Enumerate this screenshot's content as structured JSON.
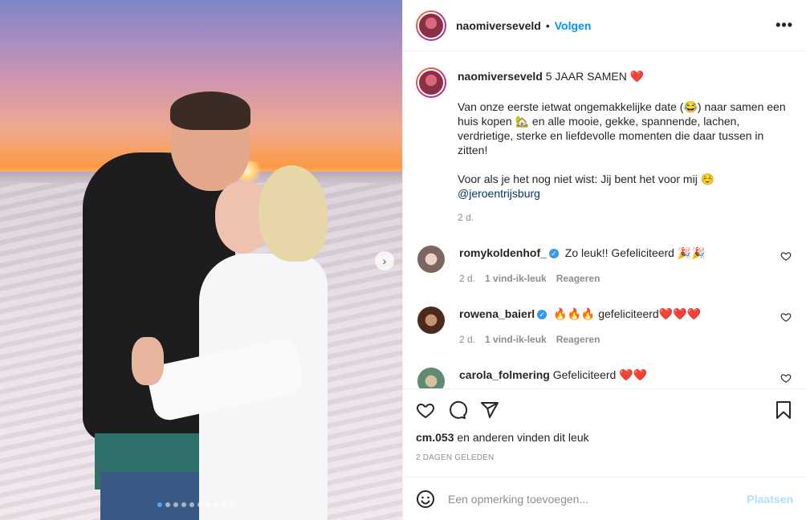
{
  "post": {
    "username": "naomiverseveld",
    "follow_label": "Volgen",
    "separator": "•",
    "more_label": "•••"
  },
  "caption": {
    "username": "naomiverseveld",
    "title": "5 JAAR SAMEN ❤️",
    "paragraph1": "Van onze eerste ietwat ongemakkelijke date (😂) naar samen een huis kopen 🏡 en alle mooie, gekke, spannende, lachen, verdrietige, sterke en liefdevolle momenten die daar tussen in zitten!",
    "paragraph2_text": "Voor als je het nog niet wist: Jij bent het voor mij ☺️",
    "mention": "@jeroentrijsburg",
    "time": "2 d."
  },
  "comments": [
    {
      "username": "romykoldenhof_",
      "verified": true,
      "text": "Zo leuk!! Gefeliciteerd 🎉🎉",
      "time": "2 d.",
      "likes": "1 vind-ik-leuk",
      "reply": "Reageren",
      "avatar_color": "#a08a86"
    },
    {
      "username": "rowena_baierl",
      "verified": true,
      "text": "🔥🔥🔥 gefeliciteerd❤️❤️❤️",
      "time": "2 d.",
      "likes": "1 vind-ik-leuk",
      "reply": "Reageren",
      "avatar_color": "#7a4a33"
    },
    {
      "username": "carola_folmering",
      "verified": false,
      "text": "Gefeliciteerd ❤️❤️",
      "avatar_color": "#6f9a7a"
    }
  ],
  "actions": {
    "liked_by": "cm.053",
    "likes_suffix": "en anderen vinden dit leuk",
    "date": "2 DAGEN GELEDEN",
    "icons": [
      "heart-icon",
      "comment-icon",
      "share-icon",
      "bookmark-icon"
    ]
  },
  "add_comment": {
    "placeholder": "Een opmerking toevoegen...",
    "post_label": "Plaatsen",
    "icon": "emoji-icon"
  },
  "carousel": {
    "slide_count": 10,
    "active_index": 0,
    "next_icon": "chevron-right-icon",
    "next_label": "›"
  },
  "colors": {
    "accent": "#0095f6",
    "mention": "#00376b",
    "muted": "#8e8e8e",
    "disabled_post": "#b2dffc"
  }
}
